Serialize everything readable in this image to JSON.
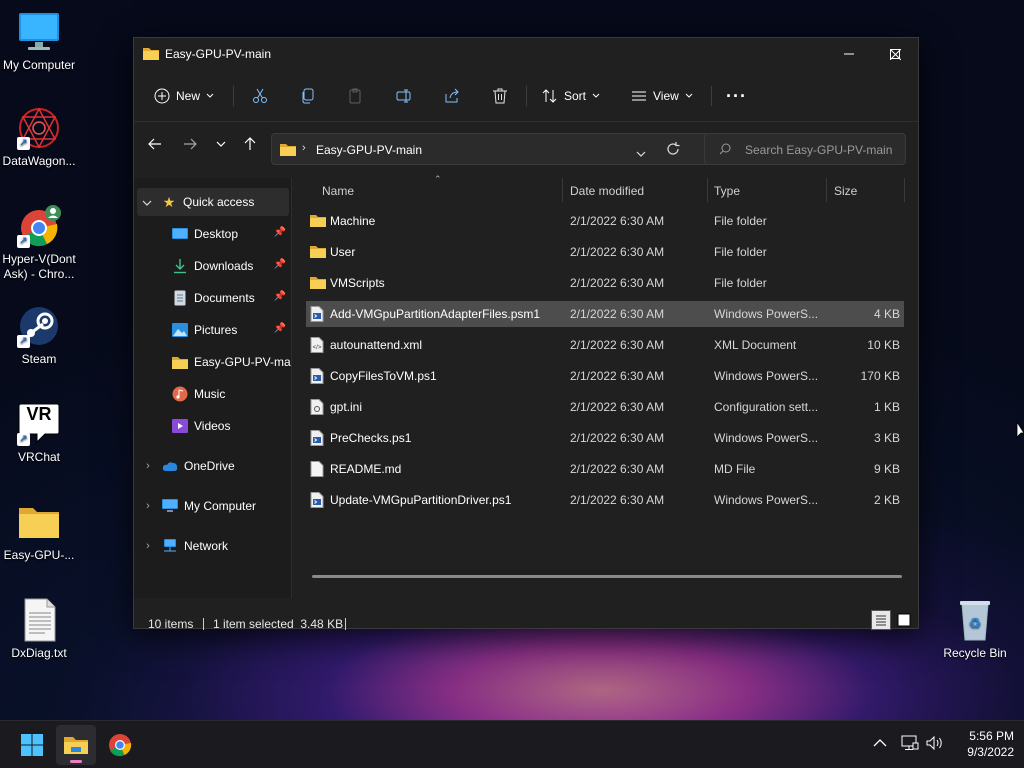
{
  "desktop": {
    "icons": [
      {
        "label": "My Computer"
      },
      {
        "label": "DataWagon..."
      },
      {
        "label": "Hyper-V(Dont Ask) - Chro..."
      },
      {
        "label": "Steam"
      },
      {
        "label": "VRChat"
      },
      {
        "label": "Easy-GPU-..."
      },
      {
        "label": "DxDiag.txt"
      },
      {
        "label": "Recycle Bin"
      }
    ],
    "vr_glyph_text": "VR"
  },
  "window": {
    "title": "Easy-GPU-PV-main",
    "controls": {
      "minimize": "minimize",
      "maximize": "maximize",
      "close": "close"
    }
  },
  "commandbar": {
    "new_label": "New",
    "sort_label": "Sort",
    "view_label": "View",
    "more_label": "···"
  },
  "address": {
    "path": "Easy-GPU-PV-main",
    "search_placeholder": "Search Easy-GPU-PV-main"
  },
  "navpane": {
    "quick_access": "Quick access",
    "items": [
      {
        "label": "Desktop",
        "pinned": true
      },
      {
        "label": "Downloads",
        "pinned": true
      },
      {
        "label": "Documents",
        "pinned": true
      },
      {
        "label": "Pictures",
        "pinned": true
      },
      {
        "label": "Easy-GPU-PV-main",
        "pinned": false
      },
      {
        "label": "Music",
        "pinned": false
      },
      {
        "label": "Videos",
        "pinned": false
      }
    ],
    "onedrive": "OneDrive",
    "my_computer": "My Computer",
    "network": "Network"
  },
  "columns": {
    "name": "Name",
    "date": "Date modified",
    "type": "Type",
    "size": "Size"
  },
  "files": [
    {
      "name": "Machine",
      "date": "2/1/2022 6:30 AM",
      "type": "File folder",
      "size": "",
      "kind": "folder"
    },
    {
      "name": "User",
      "date": "2/1/2022 6:30 AM",
      "type": "File folder",
      "size": "",
      "kind": "folder"
    },
    {
      "name": "VMScripts",
      "date": "2/1/2022 6:30 AM",
      "type": "File folder",
      "size": "",
      "kind": "folder"
    },
    {
      "name": "Add-VMGpuPartitionAdapterFiles.psm1",
      "date": "2/1/2022 6:30 AM",
      "type": "Windows PowerS...",
      "size": "4 KB",
      "kind": "ps"
    },
    {
      "name": "autounattend.xml",
      "date": "2/1/2022 6:30 AM",
      "type": "XML Document",
      "size": "10 KB",
      "kind": "xml"
    },
    {
      "name": "CopyFilesToVM.ps1",
      "date": "2/1/2022 6:30 AM",
      "type": "Windows PowerS...",
      "size": "170 KB",
      "kind": "ps"
    },
    {
      "name": "gpt.ini",
      "date": "2/1/2022 6:30 AM",
      "type": "Configuration sett...",
      "size": "1 KB",
      "kind": "ini"
    },
    {
      "name": "PreChecks.ps1",
      "date": "2/1/2022 6:30 AM",
      "type": "Windows PowerS...",
      "size": "3 KB",
      "kind": "ps"
    },
    {
      "name": "README.md",
      "date": "2/1/2022 6:30 AM",
      "type": "MD File",
      "size": "9 KB",
      "kind": "doc"
    },
    {
      "name": "Update-VMGpuPartitionDriver.ps1",
      "date": "2/1/2022 6:30 AM",
      "type": "Windows PowerS...",
      "size": "2 KB",
      "kind": "ps"
    }
  ],
  "selected_index": 3,
  "status": {
    "items": "10 items",
    "selected": "1 item selected  3.48 KB"
  },
  "taskbar": {
    "time": "5:56 PM",
    "date": "9/3/2022"
  },
  "colors": {
    "folder": "#f5c842",
    "accent": "#4cc2ff",
    "selection": "#4d4d4d"
  }
}
